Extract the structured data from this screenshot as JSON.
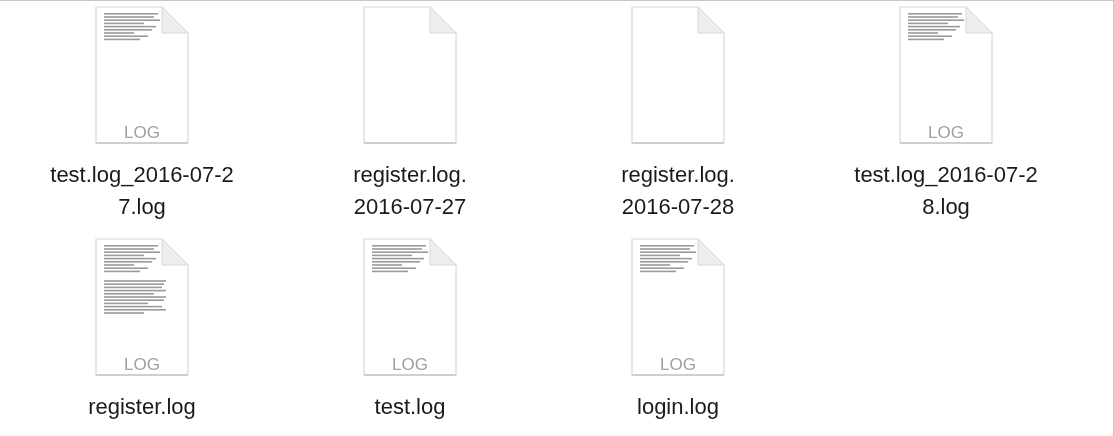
{
  "files": [
    {
      "label_lines": [
        "test.log_2016-07-2",
        "7.log"
      ],
      "kind": "short",
      "badge": "LOG"
    },
    {
      "label_lines": [
        "register.log.",
        "2016-07-27"
      ],
      "kind": "blank"
    },
    {
      "label_lines": [
        "register.log.",
        "2016-07-28"
      ],
      "kind": "blank"
    },
    {
      "label_lines": [
        "test.log_2016-07-2",
        "8.log"
      ],
      "kind": "short",
      "badge": "LOG"
    },
    {
      "label_lines": [
        "register.log"
      ],
      "kind": "long",
      "badge": "LOG"
    },
    {
      "label_lines": [
        "test.log"
      ],
      "kind": "short",
      "badge": "LOG"
    },
    {
      "label_lines": [
        "login.log"
      ],
      "kind": "short",
      "badge": "LOG"
    }
  ]
}
